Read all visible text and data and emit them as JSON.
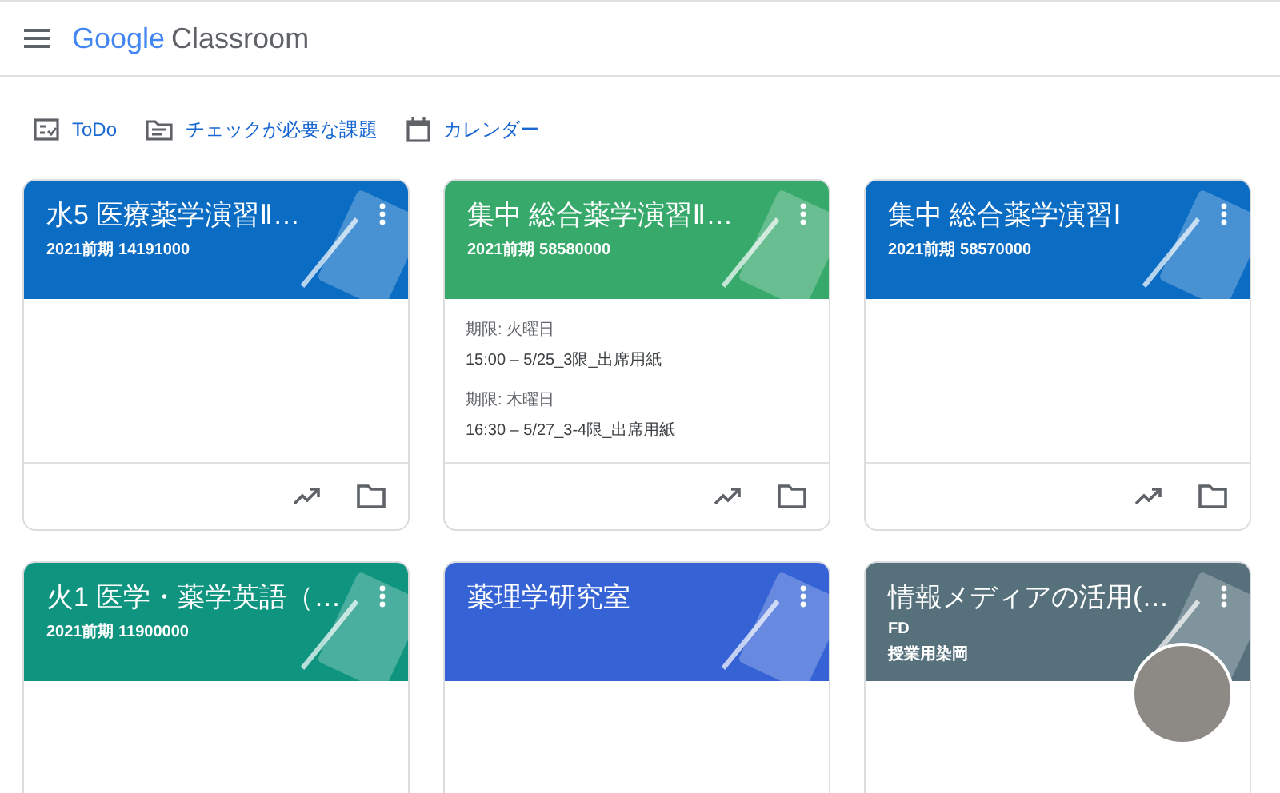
{
  "header": {
    "brand": "Google",
    "product": "Classroom"
  },
  "nav": [
    {
      "label": "ToDo"
    },
    {
      "label": "チェックが必要な課題"
    },
    {
      "label": "カレンダー"
    }
  ],
  "cards": [
    {
      "title": "水5 医療薬学演習Ⅱ…",
      "subtitles": [
        "2021前期 14191000"
      ],
      "color": "#0b6cc4",
      "footer": true,
      "teacher_photo": false
    },
    {
      "title": "集中 総合薬学演習Ⅱ…",
      "subtitles": [
        "2021前期 58580000"
      ],
      "color": "#36a96b",
      "due": [
        {
          "label": "期限: 火曜日",
          "text": "15:00 – 5/25_3限_出席用紙"
        },
        {
          "label": "期限: 木曜日",
          "text": "16:30 – 5/27_3-4限_出席用紙"
        }
      ],
      "footer": true,
      "teacher_photo": false
    },
    {
      "title": "集中 総合薬学演習Ⅰ",
      "subtitles": [
        "2021前期 58570000"
      ],
      "color": "#0b6cc4",
      "footer": true,
      "teacher_photo": false
    },
    {
      "title": "火1 医学・薬学英語（…",
      "subtitles": [
        "2021前期 11900000"
      ],
      "color": "#0f9480",
      "footer": false,
      "teacher_photo": false
    },
    {
      "title": "薬理学研究室",
      "color": "#3562d4",
      "footer": false,
      "teacher_photo": false
    },
    {
      "title": "情報メディアの活用(…",
      "subtitles": [
        "FD",
        "授業用染岡"
      ],
      "color": "#56707c",
      "footer": false,
      "teacher_photo": true
    }
  ]
}
